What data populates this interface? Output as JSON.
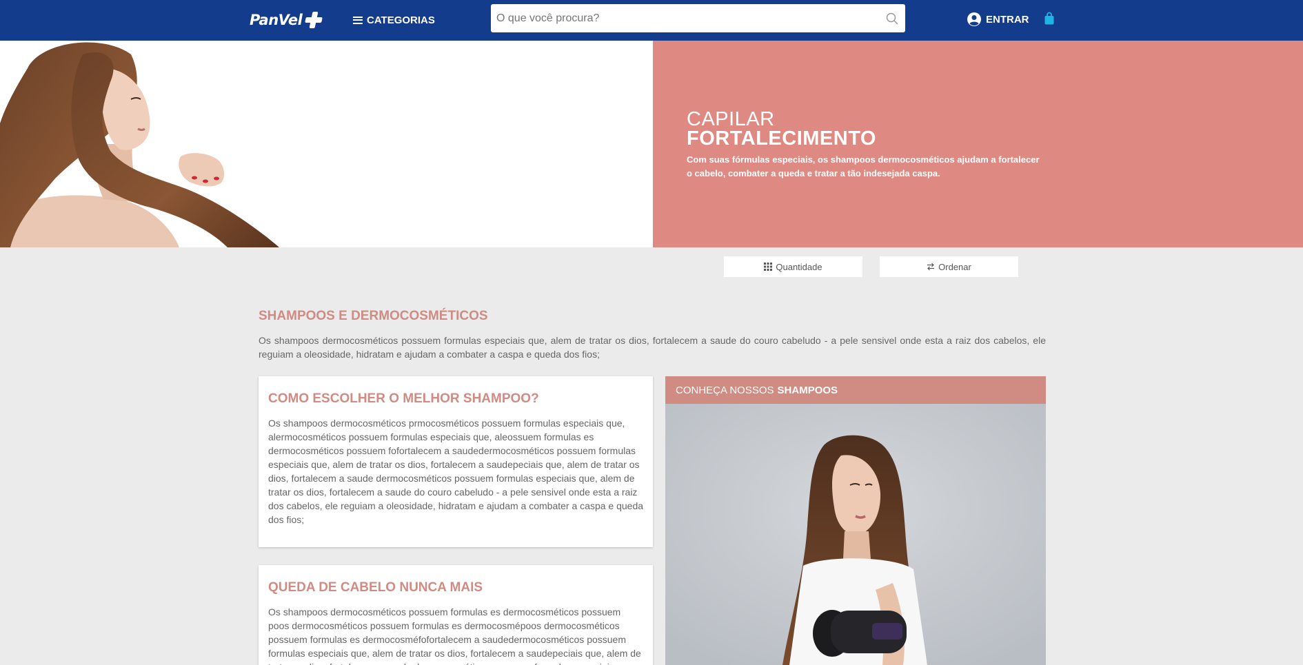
{
  "header": {
    "logo_text": "PanVel",
    "categories_label": "CATEGORIAS",
    "search_placeholder": "O que você procura?",
    "login_label": "ENTRAR"
  },
  "hero": {
    "supertitle": "CAPILAR",
    "title": "FORTALECIMENTO",
    "description": "Com suas fórmulas especiais, os shampoos dermocosméticos ajudam a fortalecer o cabelo, combater a queda e tratar a tão indesejada caspa.",
    "panel_color": "#de8a82"
  },
  "toolbar": {
    "quantity_label": "Quantidade",
    "sort_label": "Ordenar"
  },
  "section": {
    "title": "SHAMPOOS E DERMOCOSMÉTICOS",
    "description": "Os shampoos dermocosméticos possuem formulas especiais que, alem de tratar os dios, fortalecem a saude do couro cabeludo - a pele sensivel onde esta a raiz dos cabelos, ele reguiam a oleosidade, hidratam e ajudam a combater a caspa e queda dos fios;"
  },
  "cards": [
    {
      "title": "COMO ESCOLHER O MELHOR SHAMPOO?",
      "body": "Os shampoos dermocosméticos prmocosméticos possuem formulas especiais que, alermocosméticos possuem formulas especiais que, aleossuem formulas es dermocosméticos possuem fofortalecem a saudedermocosméticos possuem formulas especiais que, alem de tratar os dios, fortalecem a saudepeciais que, alem de tratar os dios, fortalecem a saude dermocosméticos possuem formulas especiais que, alem de tratar os dios, fortalecem a saude do couro cabeludo - a pele sensivel onde esta a raiz dos cabelos, ele reguiam a oleosidade, hidratam e ajudam a combater a caspa e queda dos fios;"
    },
    {
      "title": "QUEDA DE CABELO NUNCA MAIS",
      "body": "Os shampoos dermocosméticos possuem formulas es dermocosméticos possuem poos dermocosméticos possuem formulas es dermocosmépoos dermocosméticos possuem formulas es dermocosméfofortalecem a saudedermocosméticos possuem formulas especiais que, alem de tratar os dios, fortalecem a saudepeciais que, alem de tratar os dios, fortalecem a saude dermocosméticos possuem formulas especiais que"
    }
  ],
  "promo": {
    "prefix": "CONHEÇA NOSSOS",
    "highlight": "SHAMPOOS"
  },
  "colors": {
    "header_bg": "#143c8c",
    "accent": "#d08b82",
    "cart_icon": "#20b4e6"
  },
  "icons": {
    "menu": "menu-icon",
    "search": "search-icon",
    "account": "account-icon",
    "cart": "shopping-bag-icon",
    "grid": "grid-icon",
    "sort": "sort-icon"
  }
}
